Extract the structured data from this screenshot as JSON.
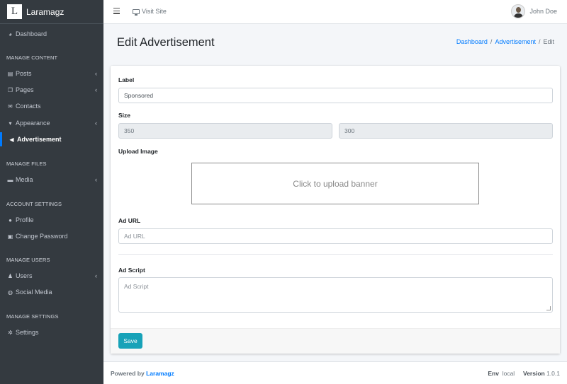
{
  "brand": {
    "logo_letter": "L",
    "name": "Laramagz"
  },
  "sidebar": {
    "dashboard": "Dashboard",
    "header_content": "MANAGE CONTENT",
    "posts": "Posts",
    "pages": "Pages",
    "contacts": "Contacts",
    "appearance": "Appearance",
    "advertisement": "Advertisement",
    "header_files": "MANAGE FILES",
    "media": "Media",
    "header_account": "ACCOUNT SETTINGS",
    "profile": "Profile",
    "change_password": "Change Password",
    "header_users": "MANAGE USERS",
    "users": "Users",
    "social_media": "Social Media",
    "header_settings": "MANAGE SETTINGS",
    "settings": "Settings",
    "chevron": "‹"
  },
  "topbar": {
    "visit_site": "Visit Site",
    "user_name": "John Doe"
  },
  "page": {
    "title": "Edit Advertisement",
    "breadcrumb": [
      "Dashboard",
      "Advertisement",
      "Edit"
    ],
    "breadcrumb_sep": "/"
  },
  "form": {
    "label_label": "Label",
    "label_value": "Sponsored",
    "size_label": "Size",
    "width_value": "350",
    "height_value": "300",
    "upload_label": "Upload Image",
    "upload_text": "Click to upload banner",
    "ad_url_label": "Ad URL",
    "ad_url_placeholder": "Ad URL",
    "ad_script_label": "Ad Script",
    "ad_script_placeholder": "Ad Script",
    "save_label": "Save"
  },
  "footer": {
    "powered_by": "Powered by",
    "powered_link": "Laramagz",
    "env_label": "Env",
    "env_value": "local",
    "version_label": "Version",
    "version_value": "1.0.1"
  },
  "colors": {
    "sidebar_bg": "#343a40",
    "accent": "#007bff",
    "save_button": "#17a2b8"
  }
}
